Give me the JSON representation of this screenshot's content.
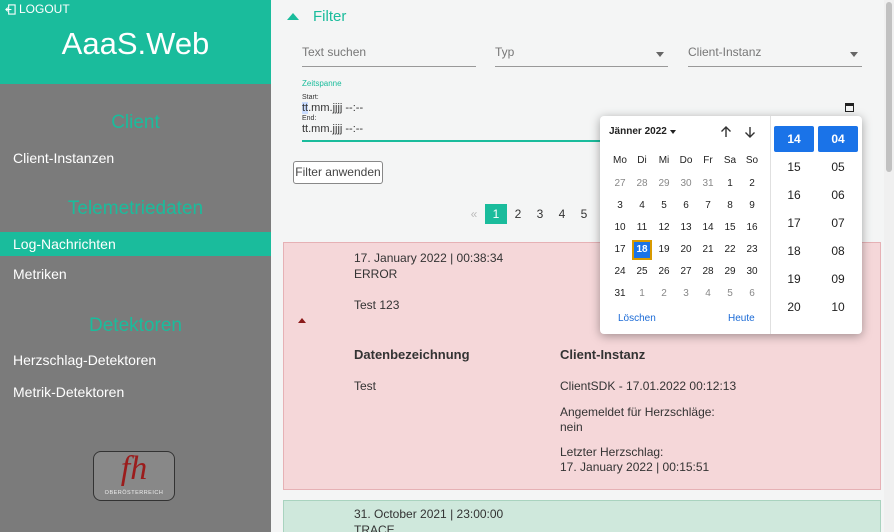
{
  "sidebar": {
    "logout_label": "LOGOUT",
    "app_title": "AaaS.Web",
    "sections": [
      "Client",
      "Telemetriedaten",
      "Detektoren"
    ],
    "items": {
      "client_instances": "Client-Instanzen",
      "log_messages": "Log-Nachrichten",
      "metrics": "Metriken",
      "heartbeat_detectors": "Herzschlag-Detektoren",
      "metric_detectors": "Metrik-Detektoren"
    },
    "logo": {
      "text": "fh",
      "sub": "OBERÖSTERREICH"
    }
  },
  "filter": {
    "title": "Filter",
    "search_placeholder": "Text suchen",
    "type_placeholder": "Typ",
    "client_placeholder": "Client-Instanz",
    "range_label": "Zeitspanne",
    "start_label": "Start:",
    "start_prefix": "tt",
    "start_rest": ".mm.jjjj --:--",
    "end_label": "End:",
    "end_value": "tt.mm.jjjj --:--",
    "apply_button": "Filter anwenden"
  },
  "pagination": {
    "prev": "«",
    "pages": [
      "1",
      "2",
      "3",
      "4",
      "5"
    ],
    "active": "1"
  },
  "log_entries": [
    {
      "timestamp": "17. January 2022 | 00:38:34",
      "level": "ERROR",
      "message": "Test 123",
      "col_data_label": "Datenbezeichnung",
      "col_client_label": "Client-Instanz",
      "data_name": "Test",
      "client_name": "ClientSDK - 17.01.2022 00:12:13",
      "registered_label": "Angemeldet für Herzschläge:",
      "registered_value": "nein",
      "last_heartbeat_label": "Letzter Herzschlag:",
      "last_heartbeat_value": "17. January 2022 | 00:15:51"
    },
    {
      "timestamp": "31. October 2021 | 23:00:00",
      "level": "TRACE"
    }
  ],
  "datepicker": {
    "month_label": "Jänner 2022",
    "weekdays": [
      "Mo",
      "Di",
      "Mi",
      "Do",
      "Fr",
      "Sa",
      "So"
    ],
    "weeks": [
      [
        "27",
        "28",
        "29",
        "30",
        "31",
        "1",
        "2"
      ],
      [
        "3",
        "4",
        "5",
        "6",
        "7",
        "8",
        "9"
      ],
      [
        "10",
        "11",
        "12",
        "13",
        "14",
        "15",
        "16"
      ],
      [
        "17",
        "18",
        "19",
        "20",
        "21",
        "22",
        "23"
      ],
      [
        "24",
        "25",
        "26",
        "27",
        "28",
        "29",
        "30"
      ],
      [
        "31",
        "1",
        "2",
        "3",
        "4",
        "5",
        "6"
      ]
    ],
    "selected_day": "18",
    "clear_label": "Löschen",
    "today_label": "Heute",
    "hours": [
      "14",
      "15",
      "16",
      "17",
      "18",
      "19",
      "20"
    ],
    "minutes": [
      "04",
      "05",
      "06",
      "07",
      "08",
      "09",
      "10"
    ],
    "selected_hour": "14",
    "selected_minute": "04"
  }
}
